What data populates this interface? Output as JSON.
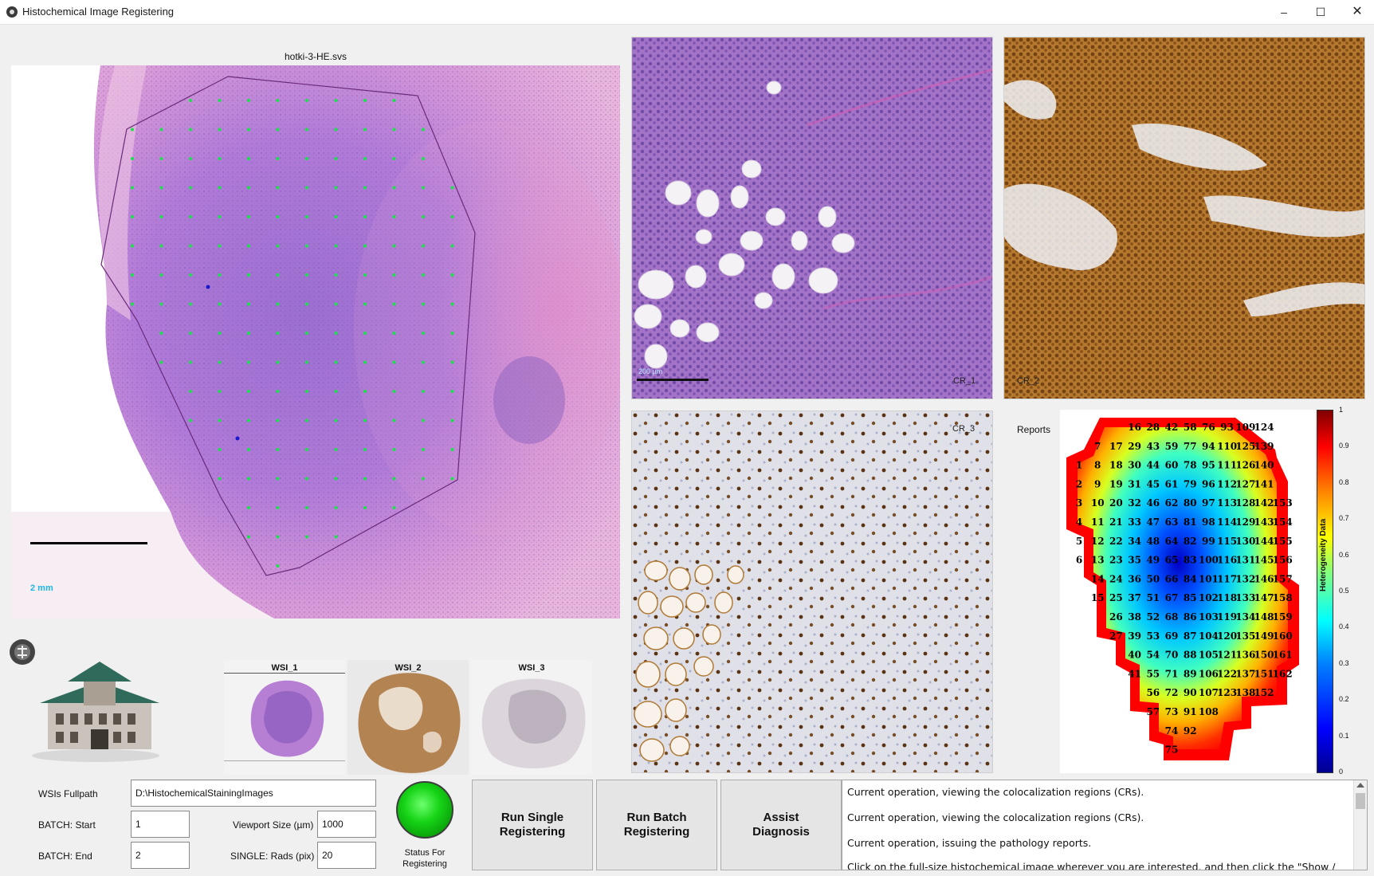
{
  "window": {
    "title": "Histochemical Image Registering",
    "minimize": "–",
    "maximize": "☐",
    "close": "✕"
  },
  "main_view": {
    "filename": "hotki-3-HE.svs",
    "scale_label": "2 mm"
  },
  "panels": {
    "cr1_label": "CR_1",
    "cr1_scale": "200 µm",
    "cr2_label": "CR_2",
    "cr3_label": "CR_3"
  },
  "reports": {
    "label": "Reports",
    "colorbar_label": "Heterogeneity Data",
    "colorbar_ticks": [
      "1",
      "0.9",
      "0.8",
      "0.7",
      "0.6",
      "0.5",
      "0.4",
      "0.3",
      "0.2",
      "0.1",
      "0"
    ],
    "grid_rows": [
      [
        "16",
        "28",
        "42",
        "58",
        "76",
        "93",
        "109",
        "124"
      ],
      [
        "7",
        "17",
        "29",
        "43",
        "59",
        "77",
        "94",
        "110",
        "125",
        "139"
      ],
      [
        "1",
        "8",
        "18",
        "30",
        "44",
        "60",
        "78",
        "95",
        "111",
        "126",
        "140"
      ],
      [
        "2",
        "9",
        "19",
        "31",
        "45",
        "61",
        "79",
        "96",
        "112",
        "127",
        "141"
      ],
      [
        "3",
        "10",
        "20",
        "32",
        "46",
        "62",
        "80",
        "97",
        "113",
        "128",
        "142",
        "153"
      ],
      [
        "4",
        "11",
        "21",
        "33",
        "47",
        "63",
        "81",
        "98",
        "114",
        "129",
        "143",
        "154"
      ],
      [
        "5",
        "12",
        "22",
        "34",
        "48",
        "64",
        "82",
        "99",
        "115",
        "130",
        "144",
        "155"
      ],
      [
        "6",
        "13",
        "23",
        "35",
        "49",
        "65",
        "83",
        "100",
        "116",
        "131",
        "145",
        "156"
      ],
      [
        "14",
        "24",
        "36",
        "50",
        "66",
        "84",
        "101",
        "117",
        "132",
        "146",
        "157"
      ],
      [
        "15",
        "25",
        "37",
        "51",
        "67",
        "85",
        "102",
        "118",
        "133",
        "147",
        "158"
      ],
      [
        "26",
        "38",
        "52",
        "68",
        "86",
        "103",
        "119",
        "134",
        "148",
        "159"
      ],
      [
        "27",
        "39",
        "53",
        "69",
        "87",
        "104",
        "120",
        "135",
        "149",
        "160"
      ],
      [
        "40",
        "54",
        "70",
        "88",
        "105",
        "121",
        "136",
        "150",
        "161"
      ],
      [
        "41",
        "55",
        "71",
        "89",
        "106",
        "122",
        "137",
        "151",
        "162"
      ],
      [
        "56",
        "72",
        "90",
        "107",
        "123",
        "138",
        "152"
      ],
      [
        "57",
        "73",
        "91",
        "108"
      ],
      [
        "74",
        "92"
      ],
      [
        "75"
      ]
    ]
  },
  "thumbnails": [
    {
      "label": "WSI_1"
    },
    {
      "label": "WSI_2"
    },
    {
      "label": "WSI_3"
    }
  ],
  "form": {
    "fullpath_label": "WSIs Fullpath",
    "fullpath_value": "D:\\HistochemicalStainingImages",
    "batch_start_label": "BATCH: Start",
    "batch_start_value": "1",
    "batch_end_label": "BATCH: End",
    "batch_end_value": "2",
    "viewport_label": "Viewport Size (µm)",
    "viewport_value": "1000",
    "rads_label": "SINGLE: Rads (pix)",
    "rads_value": "20"
  },
  "status": {
    "label": "Status For\nRegistering",
    "color": "#18d418"
  },
  "buttons": {
    "run_single": "Run Single\nRegistering",
    "run_batch": "Run Batch\nRegistering",
    "assist": "Assist\nDiagnosis"
  },
  "log": [
    "Current operation, viewing the colocalization regions (CRs).",
    "Current operation, viewing the colocalization regions (CRs).",
    "Current operation, issuing the pathology reports.",
    "Click on the full-size histochemical image wherever you are interested, and then click the \"Show /"
  ]
}
